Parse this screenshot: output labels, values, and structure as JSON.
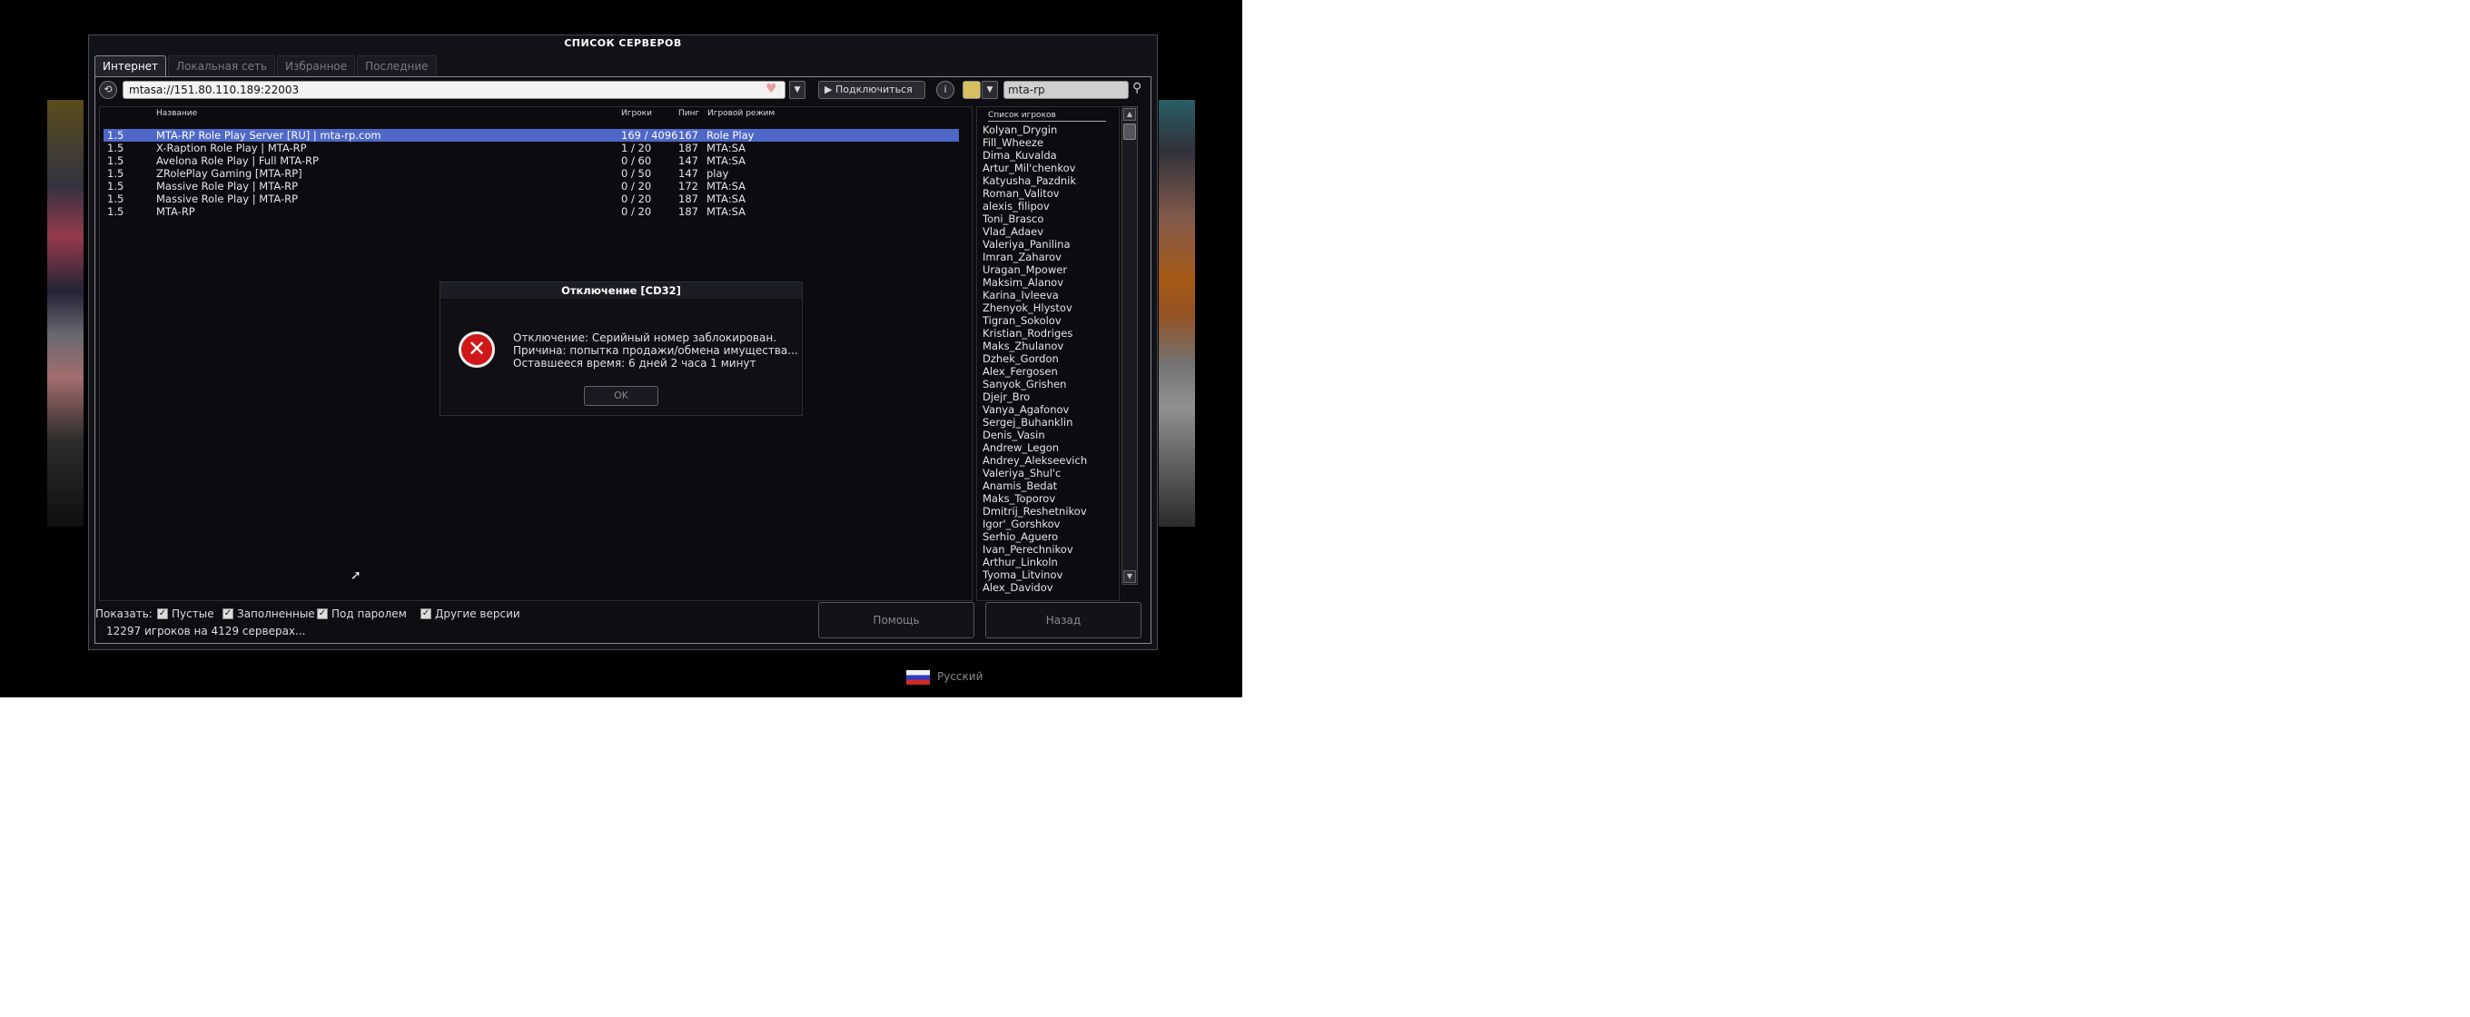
{
  "window": {
    "title": "СПИСОК СЕРВЕРОВ"
  },
  "tabs": [
    {
      "label": "Интернет",
      "active": true
    },
    {
      "label": "Локальная сеть",
      "active": false
    },
    {
      "label": "Избранное",
      "active": false
    },
    {
      "label": "Последние",
      "active": false
    }
  ],
  "toolbar": {
    "address_value": "mtasa://151.80.110.189:22003",
    "connect_label": "Подключиться",
    "search_value": "mta-rp",
    "icons": [
      "refresh-icon",
      "heart-icon",
      "play-icon",
      "info-icon",
      "search-icon"
    ]
  },
  "server_list": {
    "columns": [
      "Название",
      "Игроки",
      "Пинг",
      "Игровой режим"
    ],
    "rows": [
      {
        "version": "1.5",
        "name": "MTA-RP Role Play Server [RU] | mta-rp.com",
        "players": "169 / 4096",
        "ping": "167",
        "mode": "Role Play",
        "selected": true
      },
      {
        "version": "1.5",
        "name": "X-Raption Role Play | MTA-RP",
        "players": "1 / 20",
        "ping": "187",
        "mode": "MTA:SA",
        "selected": false
      },
      {
        "version": "1.5",
        "name": "Avelona Role Play | Full MTA-RP",
        "players": "0 / 60",
        "ping": "147",
        "mode": "MTA:SA",
        "selected": false
      },
      {
        "version": "1.5",
        "name": "ZRolePlay Gaming [MTA-RP]",
        "players": "0 / 50",
        "ping": "147",
        "mode": "play",
        "selected": false
      },
      {
        "version": "1.5",
        "name": "Massive Role Play | MTA-RP",
        "players": "0 / 20",
        "ping": "172",
        "mode": "MTA:SA",
        "selected": false
      },
      {
        "version": "1.5",
        "name": "Massive Role Play | MTA-RP",
        "players": "0 / 20",
        "ping": "187",
        "mode": "MTA:SA",
        "selected": false
      },
      {
        "version": "1.5",
        "name": "MTA-RP",
        "players": "0 / 20",
        "ping": "187",
        "mode": "MTA:SA",
        "selected": false
      }
    ]
  },
  "player_list": {
    "header": "Список игроков",
    "players": [
      "Kolyan_Drygin",
      "Fill_Wheeze",
      "Dima_Kuvalda",
      "Artur_Mil'chenkov",
      "Katyusha_Pazdnik",
      "Roman_Valitov",
      "alexis_filipov",
      "Toni_Brasco",
      "Vlad_Adaev",
      "Valeriya_Panilina",
      "Imran_Zaharov",
      "Uragan_Mpower",
      "Maksim_Alanov",
      "Karina_Ivleeva",
      "Zhenyok_Hlystov",
      "Tigran_Sokolov",
      "Kristian_Rodriges",
      "Maks_Zhulanov",
      "Dzhek_Gordon",
      "Alex_Fergosen",
      "Sanyok_Grishen",
      "Djejr_Bro",
      "Vanya_Agafonov",
      "Sergej_Buhanklin",
      "Denis_Vasin",
      "Andrew_Legon",
      "Andrey_Alekseevich",
      "Valeriya_Shul'c",
      "Anamis_Bedat",
      "Maks_Toporov",
      "Dmitrij_Reshetnikov",
      "Igor'_Gorshkov",
      "Serhio_Aguero",
      "Ivan_Perechnikov",
      "Arthur_Linkoln",
      "Tyoma_Litvinov",
      "Alex_Davidov"
    ]
  },
  "filters": {
    "show_label": "Показать:",
    "items": [
      {
        "label": "Пустые",
        "checked": true
      },
      {
        "label": "Заполненные",
        "checked": true
      },
      {
        "label": "Под паролем",
        "checked": true
      },
      {
        "label": "Другие версии",
        "checked": true
      }
    ]
  },
  "status": {
    "text": "12297 игроков на 4129 серверах..."
  },
  "buttons": {
    "help": "Помощь",
    "back": "Назад"
  },
  "dialog": {
    "title": "Отключение [CD32]",
    "lines": [
      "Отключение: Серийный номер заблокирован.",
      "Причина: попытка продажи/обмена имущества...",
      "Оставшееся время: 6 дней 2 часа 1 минут"
    ],
    "ok_label": "OK"
  },
  "language": {
    "label": "Русский"
  }
}
